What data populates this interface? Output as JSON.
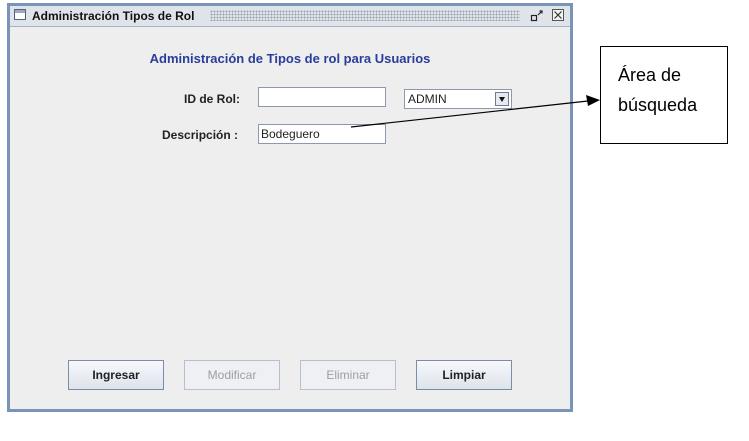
{
  "window": {
    "title": "Administración Tipos de Rol",
    "minimize_symbol": "▫ᐟ",
    "close_symbol": "✕"
  },
  "form": {
    "heading": "Administración de Tipos de rol para Usuarios",
    "id_label": "ID de Rol:",
    "id_value": "",
    "desc_label": "Descripción :",
    "desc_value": "Bodeguero",
    "role_select": {
      "selected": "ADMIN",
      "icon": "chevron-down-icon"
    }
  },
  "buttons": {
    "ingresar": "Ingresar",
    "modificar": "Modificar",
    "eliminar": "Eliminar",
    "limpiar": "Limpiar"
  },
  "callout": {
    "text": "Área de\nbúsqueda"
  },
  "colors": {
    "frame_border": "#7a93b8",
    "heading": "#2a3d9b",
    "panel_bg": "#eeeeee"
  }
}
